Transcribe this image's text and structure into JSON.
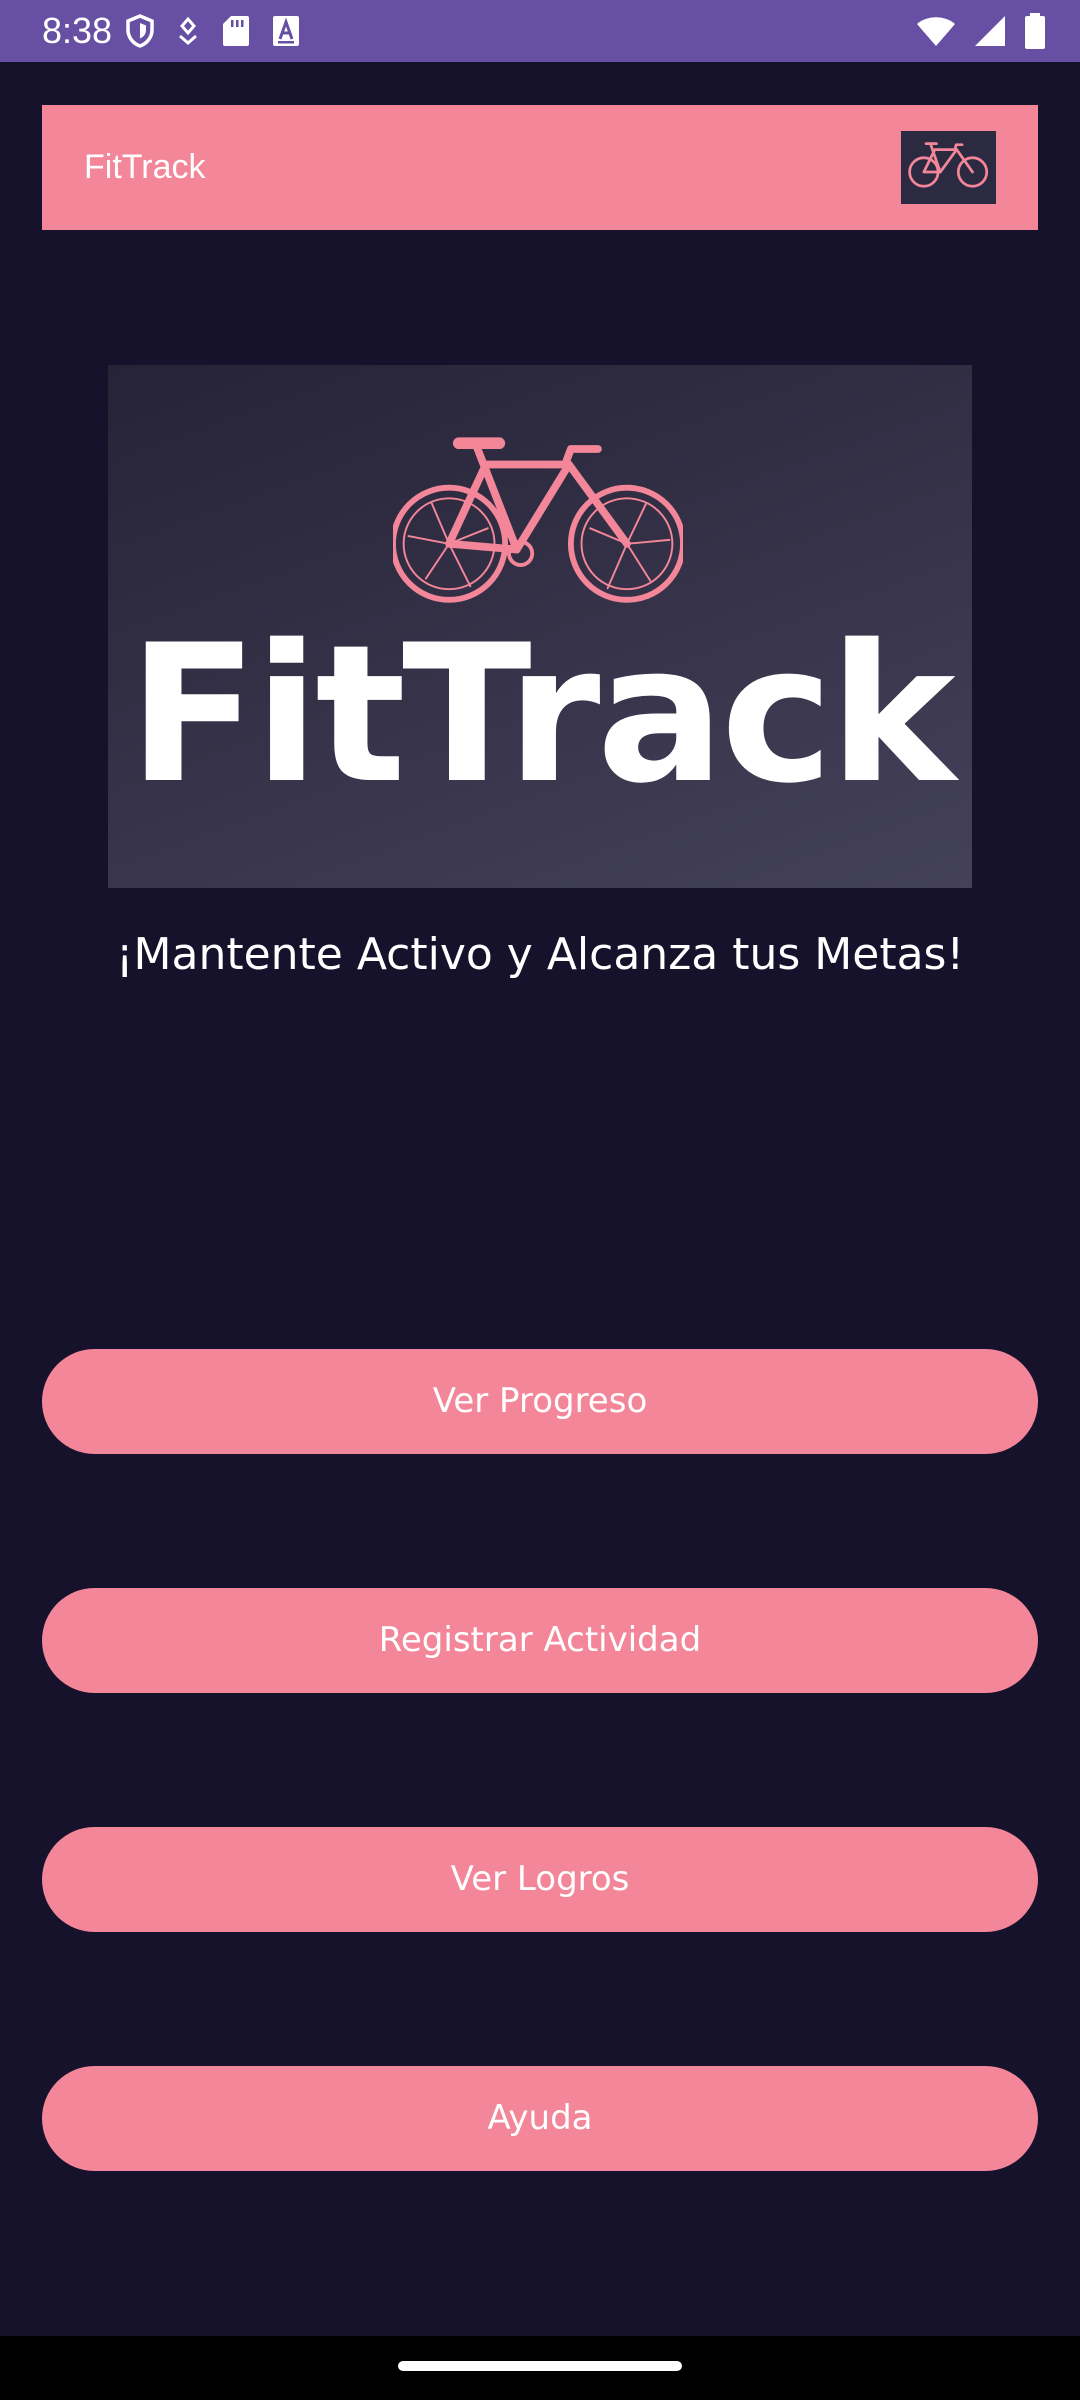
{
  "status_bar": {
    "time": "8:38",
    "left_icons": [
      "shield-icon",
      "location-pin-icon",
      "sd-card-icon",
      "keyboard-a-icon"
    ],
    "right_icons": [
      "wifi-icon",
      "signal-icon",
      "battery-icon"
    ],
    "background": "#6750a4"
  },
  "app_bar": {
    "title": "FitTrack",
    "logo_icon": "bicycle-icon",
    "background": "#f48699"
  },
  "hero": {
    "wordmark": "FitTrack",
    "icon": "bicycle-icon"
  },
  "tagline": "¡Mantente Activo y Alcanza tus Metas!",
  "buttons": {
    "progress": "Ver Progreso",
    "register": "Registrar Actividad",
    "achievements": "Ver Logros",
    "help": "Ayuda"
  },
  "colors": {
    "background": "#16122b",
    "accent": "#f48699",
    "text": "#ffffff"
  }
}
